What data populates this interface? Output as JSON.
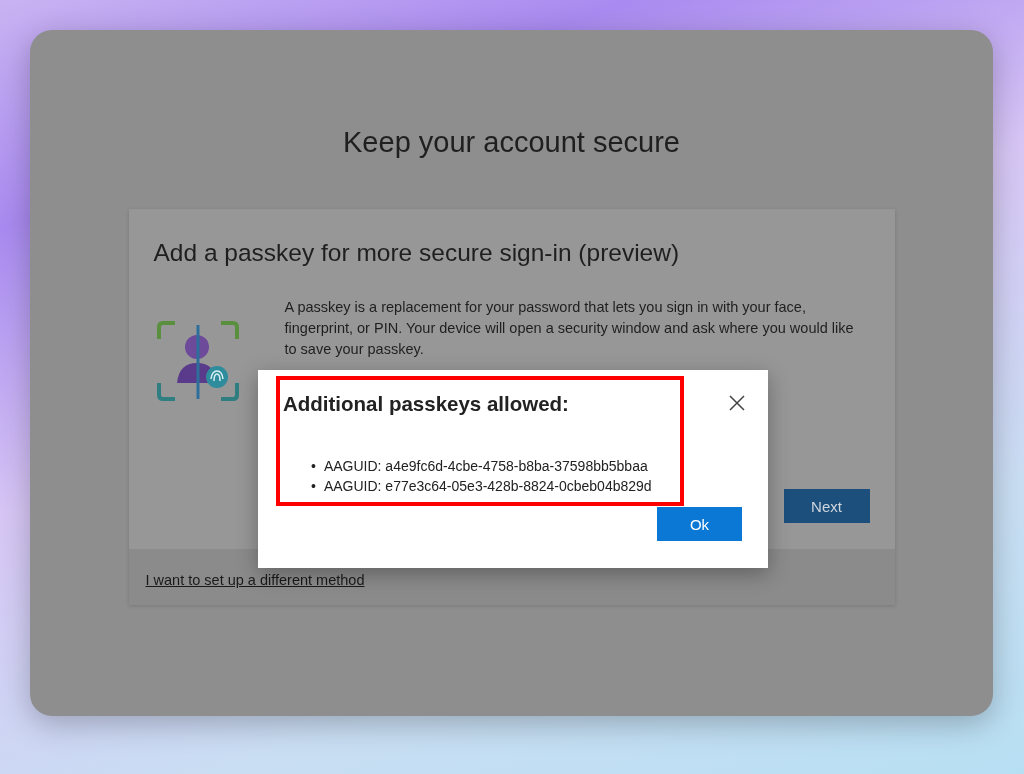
{
  "window": {
    "title": "Keep your account secure"
  },
  "card": {
    "heading": "Add a passkey for more secure sign-in (preview)",
    "description": "A passkey is a replacement for your password that lets you sign in with your face, fingerprint, or PIN. Your device will open a security window and ask where you would like to save your passkey.",
    "next_button": "Next",
    "alternate_link": "I want to set up a different method"
  },
  "dialog": {
    "title": "Additional passkeys allowed:",
    "items": [
      {
        "bullet": "•",
        "text": "AAGUID: a4e9fc6d-4cbe-4758-b8ba-37598bb5bbaa"
      },
      {
        "bullet": "•",
        "text": "AAGUID: e77e3c64-05e3-428b-8824-0cbeb04b829d"
      }
    ],
    "ok_button": "Ok"
  }
}
